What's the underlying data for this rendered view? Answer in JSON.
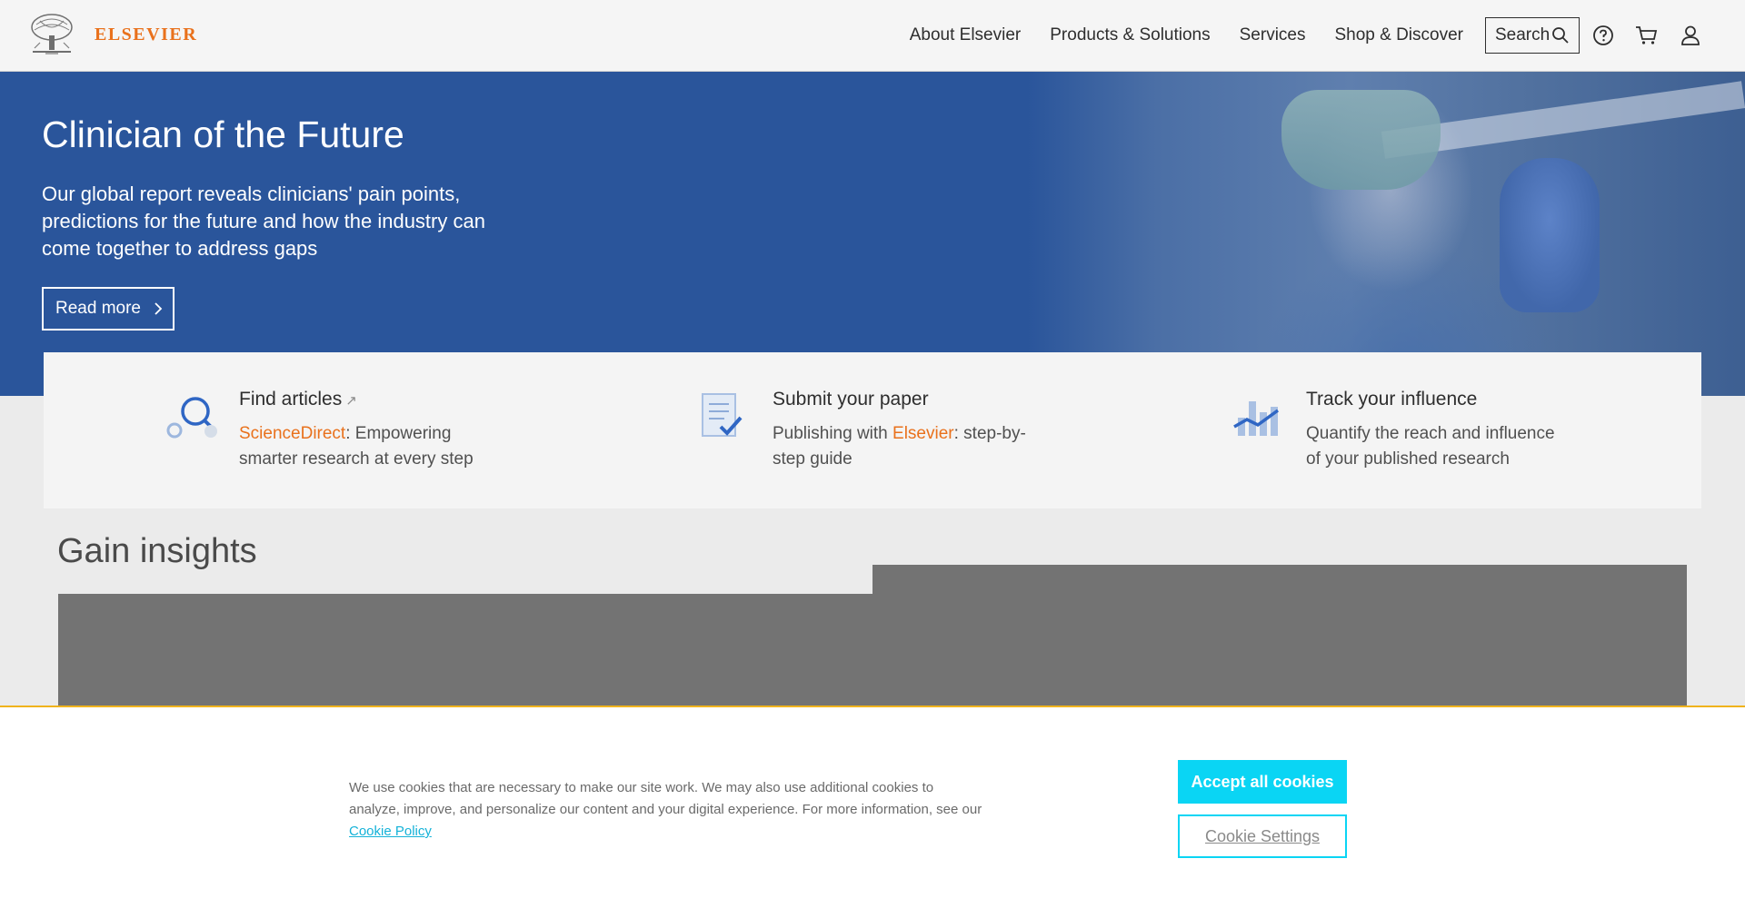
{
  "header": {
    "brand": "ELSEVIER",
    "nav": [
      {
        "label": "About Elsevier"
      },
      {
        "label": "Products & Solutions"
      },
      {
        "label": "Services"
      },
      {
        "label": "Shop & Discover"
      }
    ],
    "search_label": "Search",
    "icons": [
      "search-icon",
      "help-icon",
      "cart-icon",
      "user-icon"
    ]
  },
  "hero": {
    "title": "Clinician of the Future",
    "subtitle": "Our global report reveals clinicians' pain points, predictions for the future and how the industry can come together to address gaps",
    "cta": "Read more"
  },
  "features": [
    {
      "title": "Find articles",
      "desc_link": "ScienceDirect",
      "desc_rest": ": Empowering smarter research at every step",
      "icon": "magnifier-icon"
    },
    {
      "title": "Submit your paper",
      "desc_pre": "Publishing with ",
      "desc_link": "Elsevier",
      "desc_rest": ": step-by-step guide",
      "icon": "document-check-icon"
    },
    {
      "title": "Track your influence",
      "desc": "Quantify the reach and influence of your published research",
      "icon": "chart-icon"
    }
  ],
  "insights": {
    "title": "Gain insights"
  },
  "cookie": {
    "text": "We use cookies that are necessary to make our site work. We may also use additional cookies to analyze, improve, and personalize our content and your digital experience. For more information, see our ",
    "link": "Cookie Policy",
    "accept": "Accept all cookies",
    "settings": "Cookie Settings"
  },
  "colors": {
    "brand_orange": "#e9711c",
    "hero_blue": "#2a559b",
    "cookie_cyan": "#0ad5f4",
    "banner_border": "#f0b31c"
  }
}
